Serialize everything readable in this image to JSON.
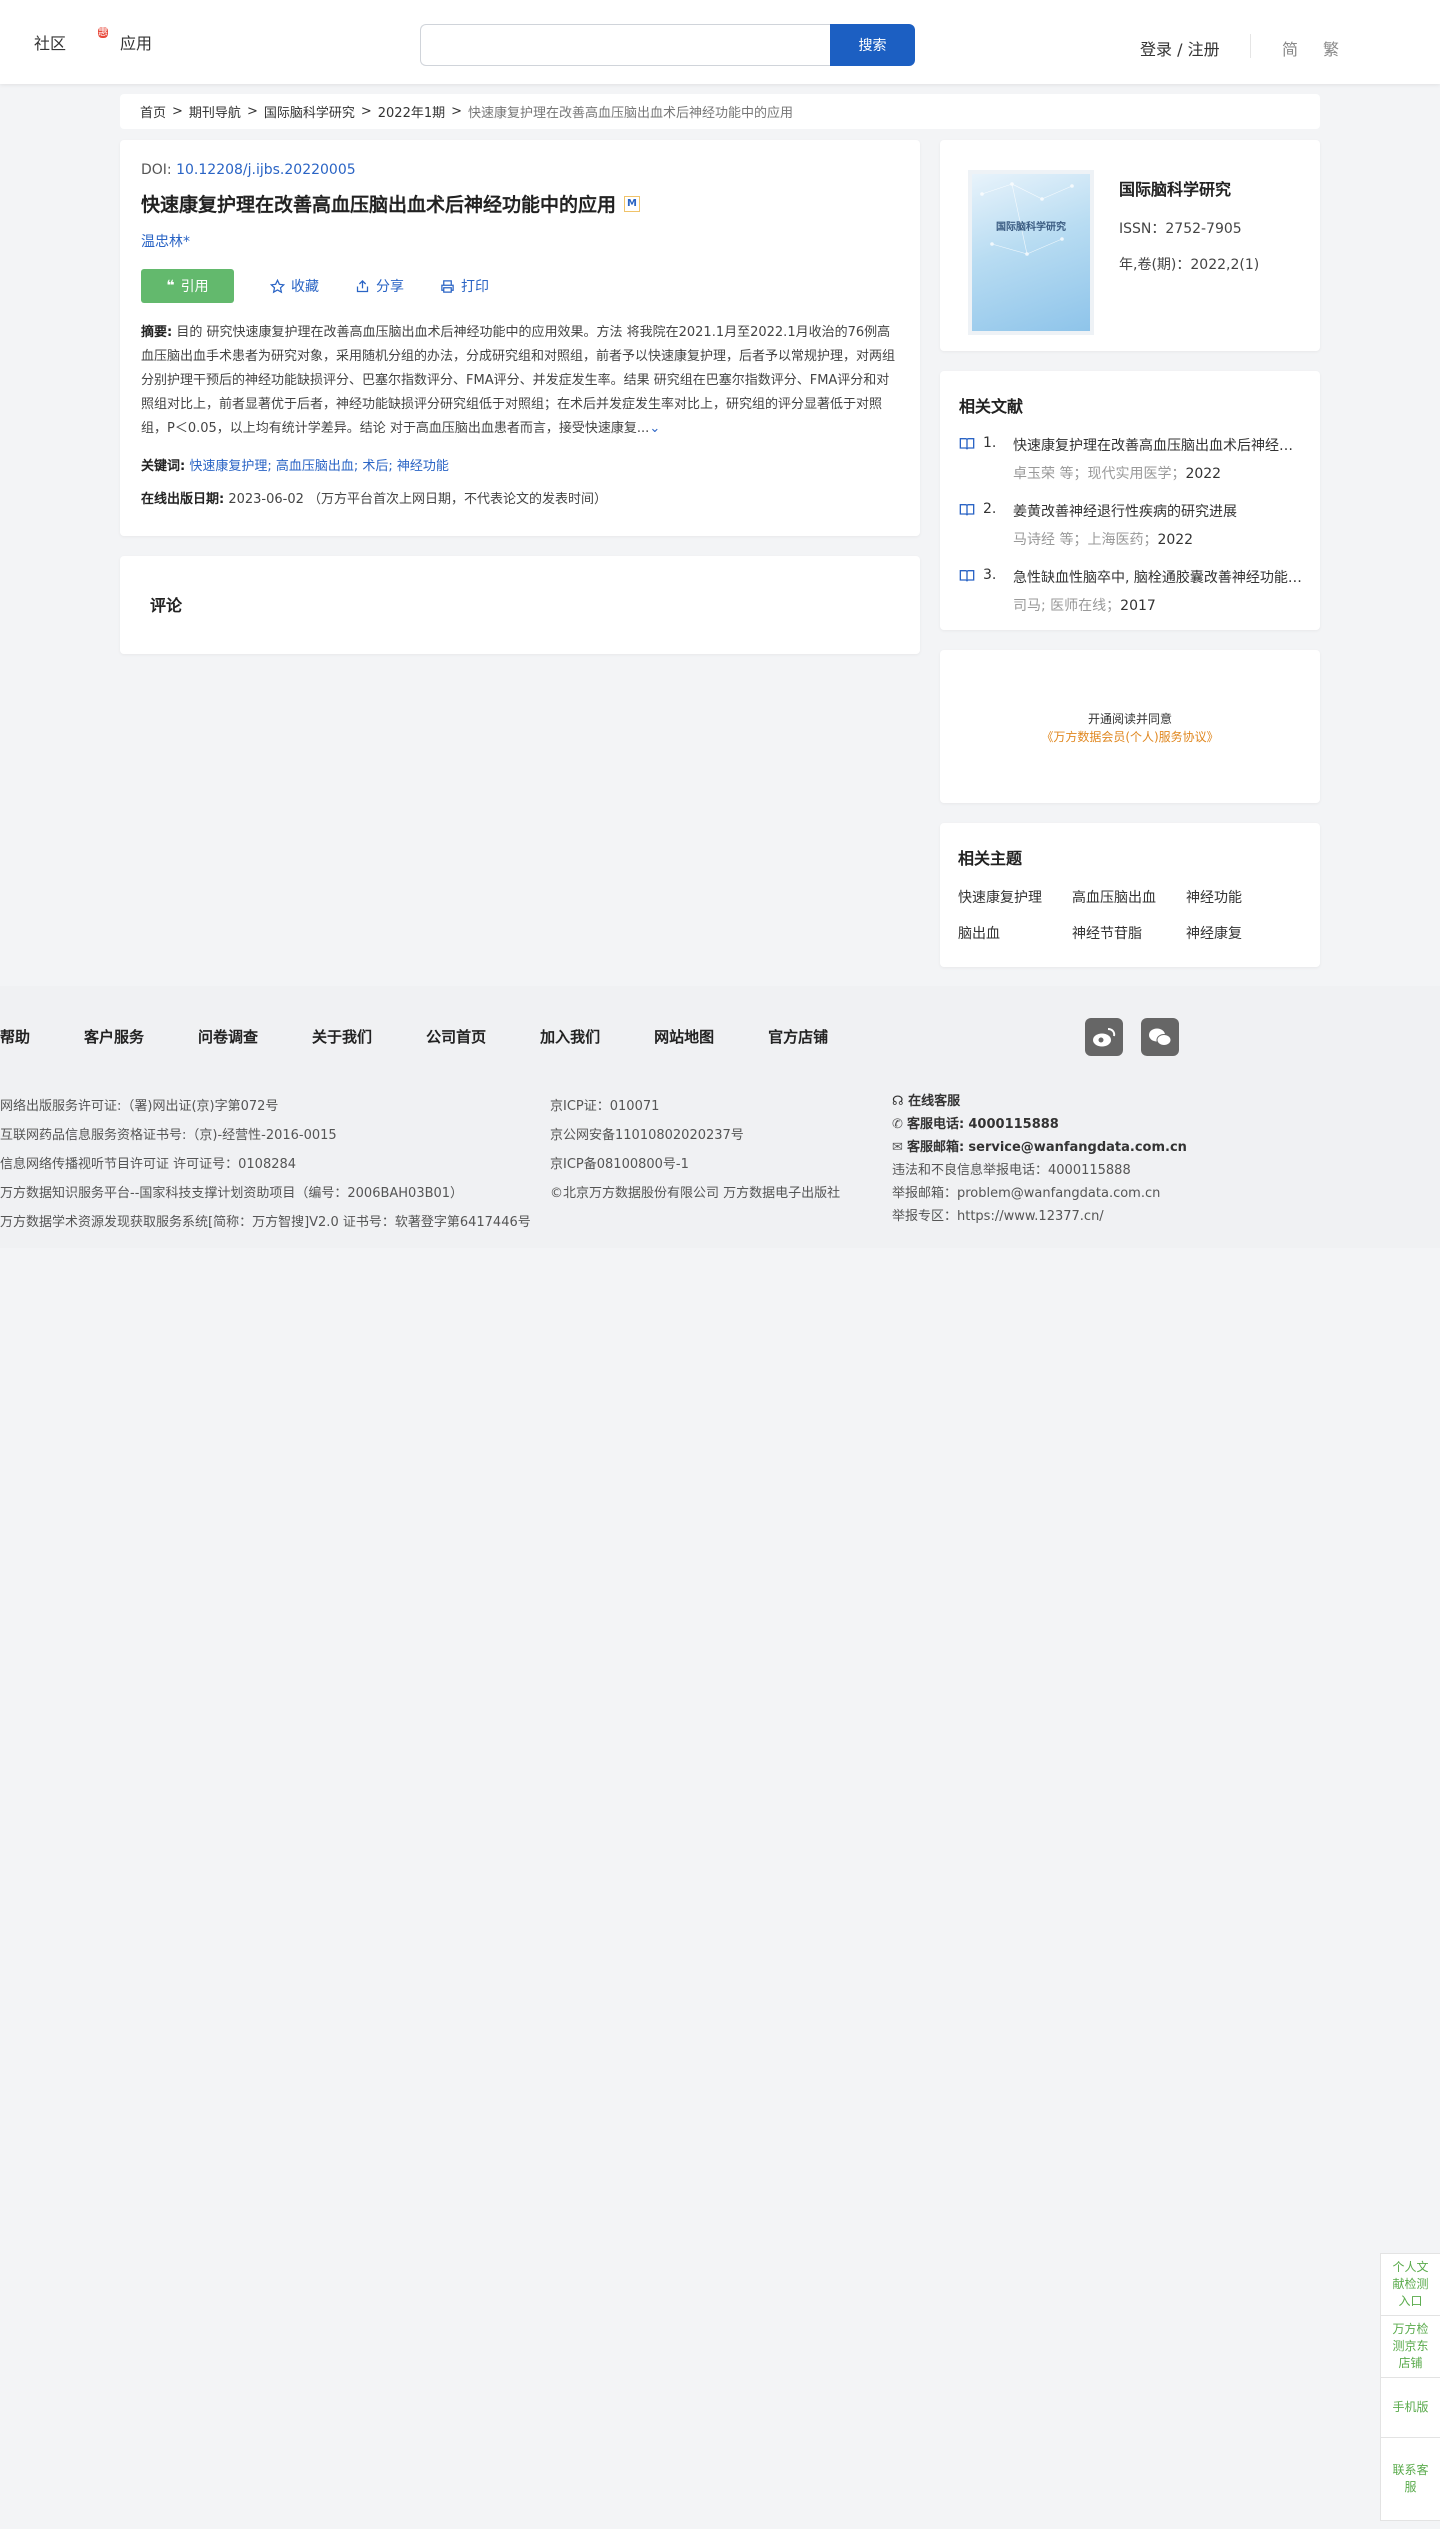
{
  "header": {
    "nav": [
      {
        "label": "社区",
        "badge": "惠"
      },
      {
        "label": "应用"
      }
    ],
    "search_placeholder": "",
    "search_button": "搜索",
    "login": "登录 / 注册",
    "lang_simplified": "简",
    "lang_traditional": "繁"
  },
  "breadcrumb": [
    "首页",
    "期刊导航",
    "国际脑科学研究",
    "2022年1期"
  ],
  "breadcrumb_current": "快速康复护理在改善高血压脑出血术后神经功能中的应用",
  "article": {
    "doi_label": "DOI: ",
    "doi": "10.12208/j.ijbs.20220005",
    "title": "快速康复护理在改善高血压脑出血术后神经功能中的应用",
    "m_badge": "M",
    "author": "温忠林*",
    "actions": {
      "cite": "引用",
      "favorite": "收藏",
      "share": "分享",
      "print": "打印"
    },
    "abstract_label": "摘要:",
    "abstract": "目的 研究快速康复护理在改善高血压脑出血术后神经功能中的应用效果。方法 将我院在2021.1月至2022.1月收治的76例高血压脑出血手术患者为研究对象，采用随机分组的办法，分成研究组和对照组，前者予以快速康复护理，后者予以常规护理，对两组分别护理干预后的神经功能缺损评分、巴塞尔指数评分、FMA评分、并发症发生率。结果 研究组在巴塞尔指数评分、FMA评分和对照组对比上，前者显著优于后者，神经功能缺损评分研究组低于对照组；在术后并发症发生率对比上，研究组的评分显著低于对照组，P＜0.05，以上均有统计学差异。结论 对于高血压脑出血患者而言，接受快速康复...",
    "keywords_label": "关键词:",
    "keywords": "快速康复护理; 高血压脑出血; 术后; 神经功能",
    "pubdate_label": "在线出版日期:",
    "pubdate": "2023-06-02 （万方平台首次上网日期，不代表论文的发表时间）"
  },
  "comment": {
    "title": "评论"
  },
  "journal": {
    "cover_title": "国际脑科学研究",
    "name": "国际脑科学研究",
    "issn": "ISSN：2752-7905",
    "volume": "年,卷(期)：2022,2(1)"
  },
  "related": {
    "title": "相关文献",
    "items": [
      {
        "idx": "1.",
        "title": "快速康复护理在改善高血压脑出血术后神经功能中的应用",
        "meta": "卓玉荣  等；现代实用医学；",
        "year": "2022"
      },
      {
        "idx": "2.",
        "title": "姜黄改善神经退行性疾病的研究进展",
        "meta": "马诗经  等；上海医药；",
        "year": "2022"
      },
      {
        "idx": "3.",
        "title": "急性缺血性脑卒中, 脑栓通胶囊改善神经功能缺损",
        "meta": "司马; 医师在线；",
        "year": "2017"
      }
    ]
  },
  "promo": {
    "line1": "开通阅读并同意",
    "line2": "《万方数据会员(个人)服务协议》"
  },
  "topics": {
    "title": "相关主题",
    "items": [
      "快速康复护理",
      "高血压脑出血",
      "神经功能",
      "脑出血",
      "神经节苷脂",
      "神经康复"
    ]
  },
  "footer": {
    "nav": [
      "帮助",
      "客户服务",
      "问卷调查",
      "关于我们",
      "公司首页",
      "加入我们",
      "网站地图",
      "官方店铺"
    ],
    "col1": [
      "网络出版服务许可证:（署)网出证(京)字第072号",
      "互联网药品信息服务资格证书号:（京)-经营性-2016-0015",
      "信息网络传播视听节目许可证 许可证号：0108284",
      "万方数据知识服务平台--国家科技支撑计划资助项目（编号：2006BAH03B01）",
      "万方数据学术资源发现获取服务系统[简称：万方智搜]V2.0 证书号：软著登字第6417446号"
    ],
    "col2": [
      "京ICP证：010071",
      "京公网安备11010802020237号",
      "京ICP备08100800号-1",
      "©北京万方数据股份有限公司 万方数据电子出版社"
    ],
    "col3": {
      "online": "在线客服",
      "phone_label": "客服电话:",
      "phone": "4000115888",
      "email_label": "客服邮箱:",
      "email": "service@wanfangdata.com.cn",
      "report_phone": "违法和不良信息举报电话：4000115888",
      "report_email": "举报邮箱：problem@wanfangdata.com.cn",
      "report_site": "举报专区：https://www.12377.cn/"
    }
  },
  "float_bar": [
    "个人文献检测入口",
    "万方检测京东店铺",
    "手机版",
    "联系客服"
  ]
}
